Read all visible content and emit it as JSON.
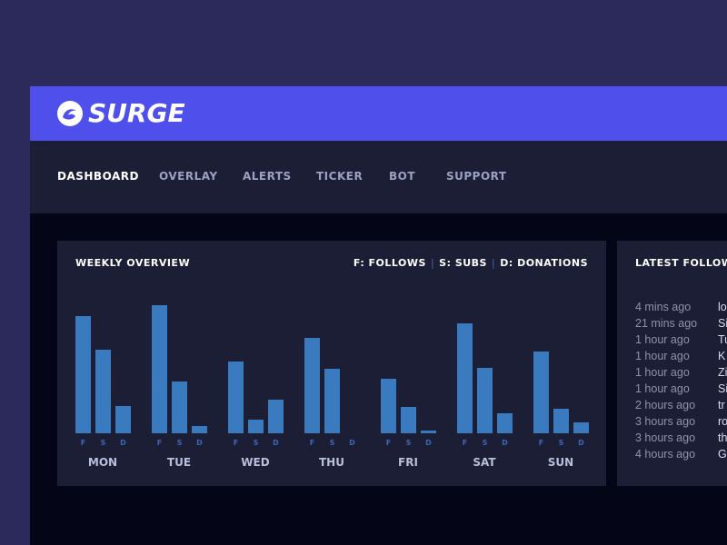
{
  "brand": {
    "name": "SURGE"
  },
  "nav": {
    "items": [
      {
        "label": "DASHBOARD",
        "active": true
      },
      {
        "label": "OVERLAY",
        "active": false
      },
      {
        "label": "ALERTS",
        "active": false
      },
      {
        "label": "TICKER",
        "active": false
      },
      {
        "label": "BOT",
        "active": false
      },
      {
        "label": "SUPPORT",
        "active": false
      }
    ]
  },
  "weekly": {
    "title": "WEEKLY OVERVIEW",
    "legend": {
      "follows": "F: FOLLOWS",
      "subs": "S: SUBS",
      "donations": "D: DONATIONS"
    }
  },
  "colors": {
    "brand": "#4f50ec",
    "bar": "#3a7bbf",
    "series_label": "#3f67b5"
  },
  "chart_data": {
    "type": "bar",
    "categories": [
      "MON",
      "TUE",
      "WED",
      "THU",
      "FRI",
      "SAT",
      "SUN"
    ],
    "series": [
      {
        "name": "F",
        "values": [
          129,
          141,
          79,
          105,
          60,
          121,
          90
        ]
      },
      {
        "name": "S",
        "values": [
          92,
          57,
          15,
          71,
          29,
          72,
          27
        ]
      },
      {
        "name": "D",
        "values": [
          30,
          8,
          37,
          0,
          3,
          22,
          12
        ]
      }
    ],
    "ylim": [
      0,
      150
    ],
    "grid": false
  },
  "latest_follows": {
    "title": "LATEST FOLLOW",
    "rows": [
      {
        "time": "4 mins ago",
        "name": "lo"
      },
      {
        "time": "21 mins ago",
        "name": "Si"
      },
      {
        "time": "1 hour ago",
        "name": "Tu"
      },
      {
        "time": "1 hour ago",
        "name": "K"
      },
      {
        "time": "1 hour ago",
        "name": "Zi"
      },
      {
        "time": "1 hour ago",
        "name": "Si"
      },
      {
        "time": "2 hours ago",
        "name": "tr"
      },
      {
        "time": "3 hours ago",
        "name": "ro"
      },
      {
        "time": "3 hours ago",
        "name": "th"
      },
      {
        "time": "4 hours ago",
        "name": "G"
      }
    ]
  }
}
